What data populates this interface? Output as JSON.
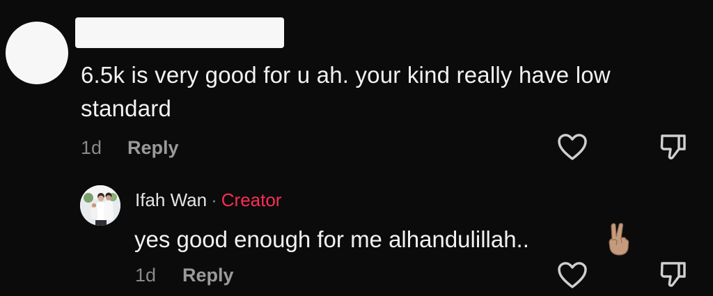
{
  "comment": {
    "text": "6.5k is very good for u ah. your kind really have low standard",
    "time": "1d",
    "reply_label": "Reply"
  },
  "reply": {
    "author": "Ifah Wan",
    "separator": "·",
    "badge": "Creator",
    "text": "yes good enough for me alhandulillah..",
    "emoji_icon": "victory-hand-emoji",
    "time": "1d",
    "reply_label": "Reply"
  },
  "colors": {
    "background": "#0b0b0b",
    "creator_badge": "#fe2c55",
    "muted_text": "#8a8a8a"
  },
  "icons": {
    "like": "heart-outline-icon",
    "dislike": "thumbs-down-outline-icon"
  }
}
